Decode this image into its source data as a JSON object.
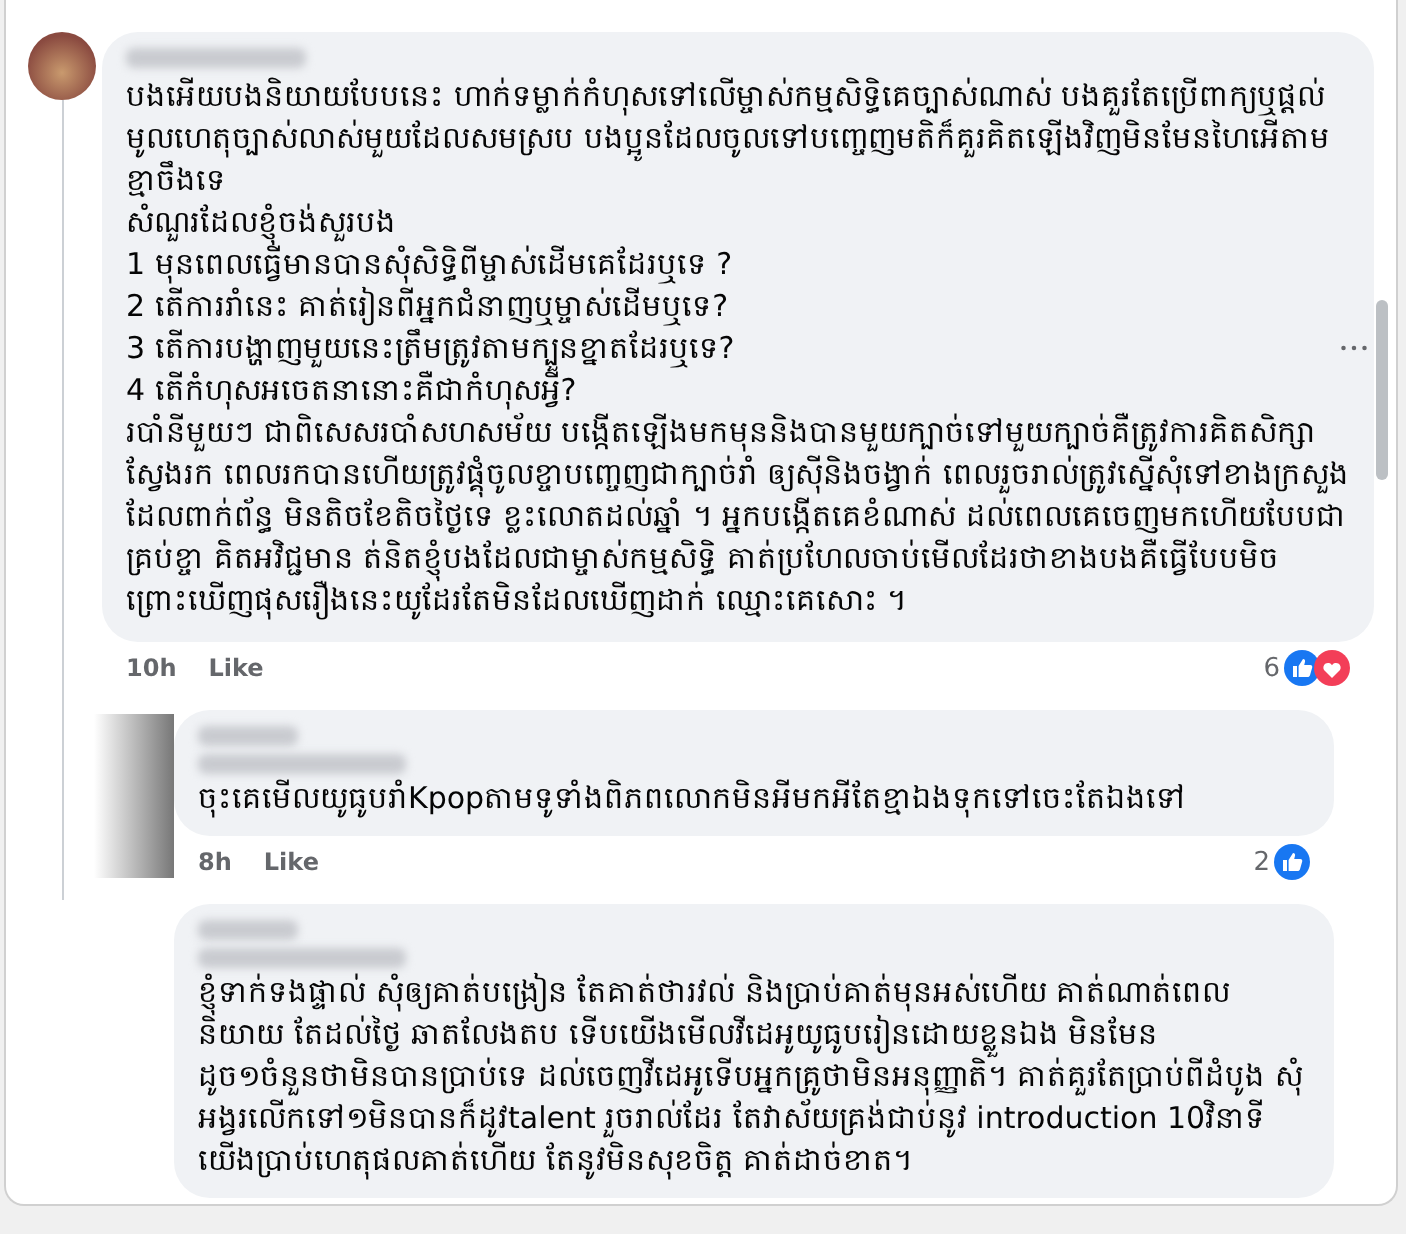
{
  "comment": {
    "paragraphs": [
      "បងអើយបងនិយាយបែបនេះ ហាក់ទម្លាក់កំហុសទៅលើម្ចាស់កម្មសិទ្ធិគេច្បាស់ណាស់ បងគួរតែប្រើពាក្យឬផ្តល់មូលហេតុច្បាស់លាស់មួយដែលសមស្រប បងប្អូនដែលចូលទៅបញ្ចេញមតិក៏គួរគិតឡើងវិញមិនមែនហៃអើតាមខ្មាចឹងទេ",
      "សំណួរដែលខ្ញុំចង់សួរបង",
      "1 មុនពេលធ្វើមានបានសុំសិទ្ធិពីម្ចាស់ដើមគេដែរឬទេ ?",
      "2 តើការរាំនេះ គាត់រៀនពីអ្នកជំនាញឬម្ចាស់ដើមឬទេ?",
      "3 តើការបង្ហាញមួយនេះត្រឹមត្រូវតាមក្បួនខ្នាតដែរឬទេ?",
      "4 តើកំហុសអចេតនានោះគឺជាកំហុសអ្វី?",
      "របាំនីមួយៗ ជាពិសេសរបាំសហសម័យ បង្កើតឡើងមកមុននិងបានមួយក្បាច់ទៅមួយក្បាច់គឺត្រូវការគិតសិក្សាស្វែងរក ពេលរកបានហើយត្រូវផ្គុំចូលខ្ចាបញ្ចេញជាក្បាច់រាំ ឲ្យស៊ីនិងចង្វាក់ ពេលរួចរាល់ត្រូវស្នើសុំទៅខាងក្រសួងដែលពាក់ព័ន្ធ មិនតិចខែតិចថ្ងៃទេ ខ្លះលោតដល់ឆ្នាំ ។ អ្នកបង្កើតគេខំណាស់ ដល់ពេលគេចេញមកហើយបែបជាគ្រប់ខ្ចា គិតអវិជ្ជមាន ត់និតខ្ញុំបងដែលជាម្ចាស់កម្មសិទ្ធិ គាត់ប្រហែលចាប់មើលដែរថាខាងបងគឺធ្វើបែបមិច ព្រោះឃើញផុសរឿងនេះយូដែរតែមិនដែលឃើញដាក់ ឈ្មោះគេសោះ ។"
    ],
    "time": "10h",
    "like": "Like",
    "reaction_count": "6",
    "reactions": [
      {
        "kind": "like"
      },
      {
        "kind": "love"
      }
    ]
  },
  "replies": [
    {
      "has_photo": true,
      "text": "ចុះគេមើលយូធូបរាំKpopតាមទូទាំងពិភពលោកមិនអីមកអីតែខ្មាឯងទុកទៅចេះតែឯងទៅ",
      "time": "8h",
      "like": "Like",
      "reaction_count": "2",
      "reactions": [
        {
          "kind": "like"
        }
      ]
    },
    {
      "has_photo": false,
      "text": "ខ្ញុំទាក់ទងផ្ទាល់ សុំឲ្យគាត់បង្រៀន តែគាត់ថារវល់ និងប្រាប់គាត់មុនអស់ហើយ គាត់ណាត់ពេលនិយាយ តែដល់ថ្ងៃ ឆាតលែងតប ទើបយើងមើលវីដេអូយូធូបរៀនដោយខ្លួនឯង មិនមែនដូច១ចំនួនថាមិនបានប្រាប់ទេ ដល់ចេញវីដេអូទើបអ្នកគ្រូថាមិនអនុញ្ញាតិ។ គាត់គួរតែប្រាប់ពីដំបូង សុំអង្វរលើកទៅ១មិនបានក៏ដូវtalent រួចរាល់ដែរ តែវាស័យគ្រង់ជាប់នូវ introduction 10វិនាទី យើងប្រាប់ហេតុផលគាត់ហើយ តែនូវមិនសុខចិត្ត គាត់ដាច់ខាត។"
    }
  ]
}
